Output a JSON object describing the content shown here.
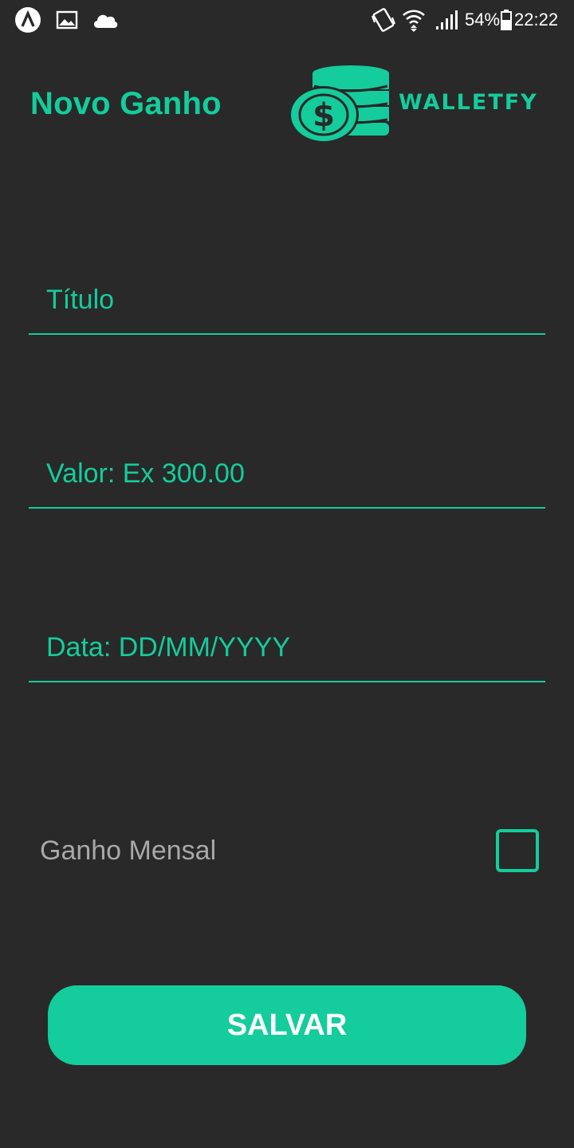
{
  "status_bar": {
    "icons": [
      "app-notification-icon",
      "image-icon",
      "cloud-icon",
      "vibrate-icon",
      "wifi-icon",
      "signal-icon",
      "battery-icon"
    ],
    "battery": "54%",
    "time": "22:22"
  },
  "header": {
    "title": "Novo Ganho",
    "logo_text": "WALLETFY"
  },
  "form": {
    "title_placeholder": "Título",
    "value_placeholder": "Valor: Ex 300.00",
    "date_placeholder": "Data: DD/MM/YYYY",
    "monthly_label": "Ganho Mensal",
    "monthly_checked": false,
    "save_label": "SALVAR"
  },
  "colors": {
    "accent": "#14cc9c",
    "background": "#292929",
    "muted_text": "#a8a8a8"
  }
}
